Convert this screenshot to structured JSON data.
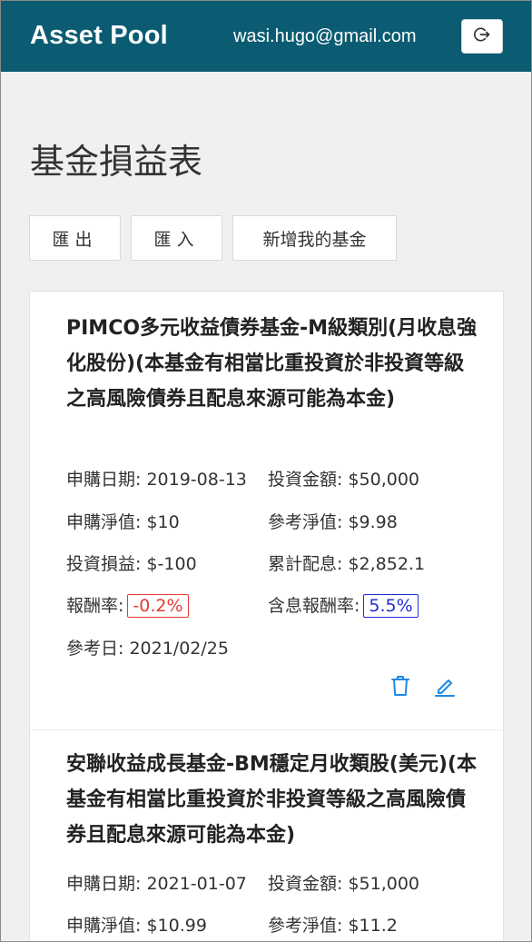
{
  "header": {
    "brand": "Asset Pool",
    "email": "wasi.hugo@gmail.com",
    "logout_icon": "logout-icon"
  },
  "page": {
    "title": "基金損益表"
  },
  "toolbar": {
    "export_label": "匯出",
    "import_label": "匯入",
    "add_label": "新增我的基金"
  },
  "funds": [
    {
      "title": "PIMCO多元收益債券基金-M級類別(月收息強化股份)(本基金有相當比重投資於非投資等級之高風險債券且配息來源可能為本金)",
      "purchase_date_label": "申購日期:",
      "purchase_date": "2019-08-13",
      "amount_label": "投資金額:",
      "amount": "$50,000",
      "purchase_nav_label": "申購淨值:",
      "purchase_nav": "$10",
      "ref_nav_label": "參考淨值:",
      "ref_nav": "$9.98",
      "pnl_label": "投資損益:",
      "pnl": "$-100",
      "dividend_label": "累計配息:",
      "dividend": "$2,852.1",
      "return_label": "報酬率:",
      "return": "-0.2%",
      "total_return_label": "含息報酬率:",
      "total_return": "5.5%",
      "ref_date_label": "參考日:",
      "ref_date": "2021/02/25",
      "status_colors": {
        "negative": "#e53935",
        "positive": "#1e2fd6"
      },
      "icons": {
        "delete": "trash-icon",
        "edit": "pencil-icon"
      }
    },
    {
      "title": "安聯收益成長基金-BM穩定月收類股(美元)(本基金有相當比重投資於非投資等級之高風險債券且配息來源可能為本金)",
      "purchase_date_label": "申購日期:",
      "purchase_date": "2021-01-07",
      "amount_label": "投資金額:",
      "amount": "$51,000",
      "purchase_nav_label": "申購淨值:",
      "purchase_nav": "$10.99",
      "ref_nav_label": "參考淨值:",
      "ref_nav": "$11.2"
    }
  ],
  "colors": {
    "header_bg": "#0b5c72",
    "accent": "#1e88e5"
  }
}
